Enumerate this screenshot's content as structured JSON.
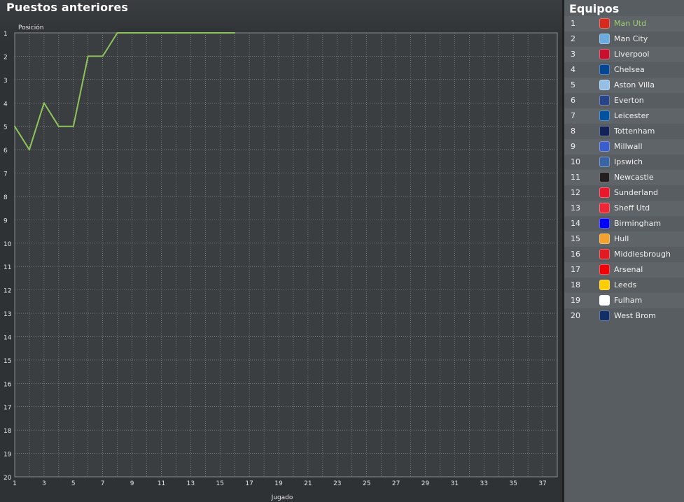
{
  "header": {
    "title": "Puestos anteriores"
  },
  "sidebar": {
    "title": "Equipos",
    "highlight_color": "#9ecf6e",
    "teams": [
      {
        "pos": "1",
        "name": "Man Utd",
        "badge_color": "#d52b1e",
        "highlight": true
      },
      {
        "pos": "2",
        "name": "Man City",
        "badge_color": "#6cabdd"
      },
      {
        "pos": "3",
        "name": "Liverpool",
        "badge_color": "#c8102e"
      },
      {
        "pos": "4",
        "name": "Chelsea",
        "badge_color": "#034694"
      },
      {
        "pos": "5",
        "name": "Aston Villa",
        "badge_color": "#95bfe5"
      },
      {
        "pos": "6",
        "name": "Everton",
        "badge_color": "#274488"
      },
      {
        "pos": "7",
        "name": "Leicester",
        "badge_color": "#0053a0"
      },
      {
        "pos": "8",
        "name": "Tottenham",
        "badge_color": "#132257"
      },
      {
        "pos": "9",
        "name": "Millwall",
        "badge_color": "#3a5fcd"
      },
      {
        "pos": "10",
        "name": "Ipswich",
        "badge_color": "#3a64a3"
      },
      {
        "pos": "11",
        "name": "Newcastle",
        "badge_color": "#241f20"
      },
      {
        "pos": "12",
        "name": "Sunderland",
        "badge_color": "#eb172b"
      },
      {
        "pos": "13",
        "name": "Sheff Utd",
        "badge_color": "#ee2737"
      },
      {
        "pos": "14",
        "name": "Birmingham",
        "badge_color": "#0000ff"
      },
      {
        "pos": "15",
        "name": "Hull",
        "badge_color": "#f5a12d"
      },
      {
        "pos": "16",
        "name": "Middlesbrough",
        "badge_color": "#e11b22"
      },
      {
        "pos": "17",
        "name": "Arsenal",
        "badge_color": "#ef0107"
      },
      {
        "pos": "18",
        "name": "Leeds",
        "badge_color": "#ffcd00"
      },
      {
        "pos": "19",
        "name": "Fulham",
        "badge_color": "#ffffff"
      },
      {
        "pos": "20",
        "name": "West Brom",
        "badge_color": "#122f67"
      }
    ]
  },
  "chart_data": {
    "type": "line",
    "title": "",
    "xlabel": "Jugado",
    "ylabel": "Posición",
    "xlim": [
      1,
      38
    ],
    "ylim": [
      1,
      20
    ],
    "y_inverted": true,
    "grid": true,
    "x_ticks": [
      "1",
      "3",
      "5",
      "7",
      "9",
      "11",
      "13",
      "15",
      "17",
      "19",
      "21",
      "23",
      "25",
      "27",
      "29",
      "31",
      "33",
      "35",
      "37"
    ],
    "y_ticks": [
      "1",
      "2",
      "3",
      "4",
      "5",
      "6",
      "7",
      "8",
      "9",
      "10",
      "11",
      "12",
      "13",
      "14",
      "15",
      "16",
      "17",
      "18",
      "19",
      "20"
    ],
    "series": [
      {
        "color": "#8fc45a",
        "x": [
          1,
          2,
          3,
          4,
          5,
          6,
          7,
          8,
          9,
          10,
          11,
          12,
          13,
          14,
          15,
          16
        ],
        "y": [
          5,
          6,
          4,
          5,
          5,
          2,
          2,
          1,
          1,
          1,
          1,
          1,
          1,
          1,
          1,
          1
        ]
      }
    ]
  }
}
